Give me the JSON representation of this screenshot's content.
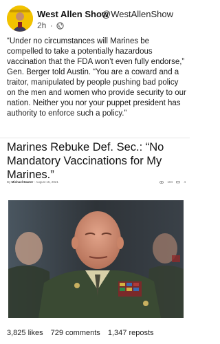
{
  "post": {
    "author_name": "West Allen Show",
    "author_handle": "@WestAllenShow",
    "time": "2h",
    "separator": "·",
    "text": "“Under no circumstances will Marines be compelled to take a potentially hazardous vaccination that the FDA won’t even fully endorse,” Gen. Berger told Austin. “You are a coward and a traitor, manipulated by people pushing bad policy on the men and women who provide security to our nation. Neither you nor your puppet president has authority to enforce such a policy.”"
  },
  "article": {
    "title": "Marines Rebuke Def. Sec.: “No Mandatory Vaccinations for My Marines.”",
    "byline_prefix": "By",
    "byline_author": "Michael Baxter",
    "byline_sep": "-",
    "date": "August 15, 2021",
    "views": "104",
    "comments": "4"
  },
  "engagement": {
    "likes": "3,825 likes",
    "comments": "729 comments",
    "reposts": "1,347 reposts"
  },
  "colors": {
    "avatar_bg": "#f2c200",
    "uniform": "#3a4a33",
    "background": "#ffffff"
  }
}
